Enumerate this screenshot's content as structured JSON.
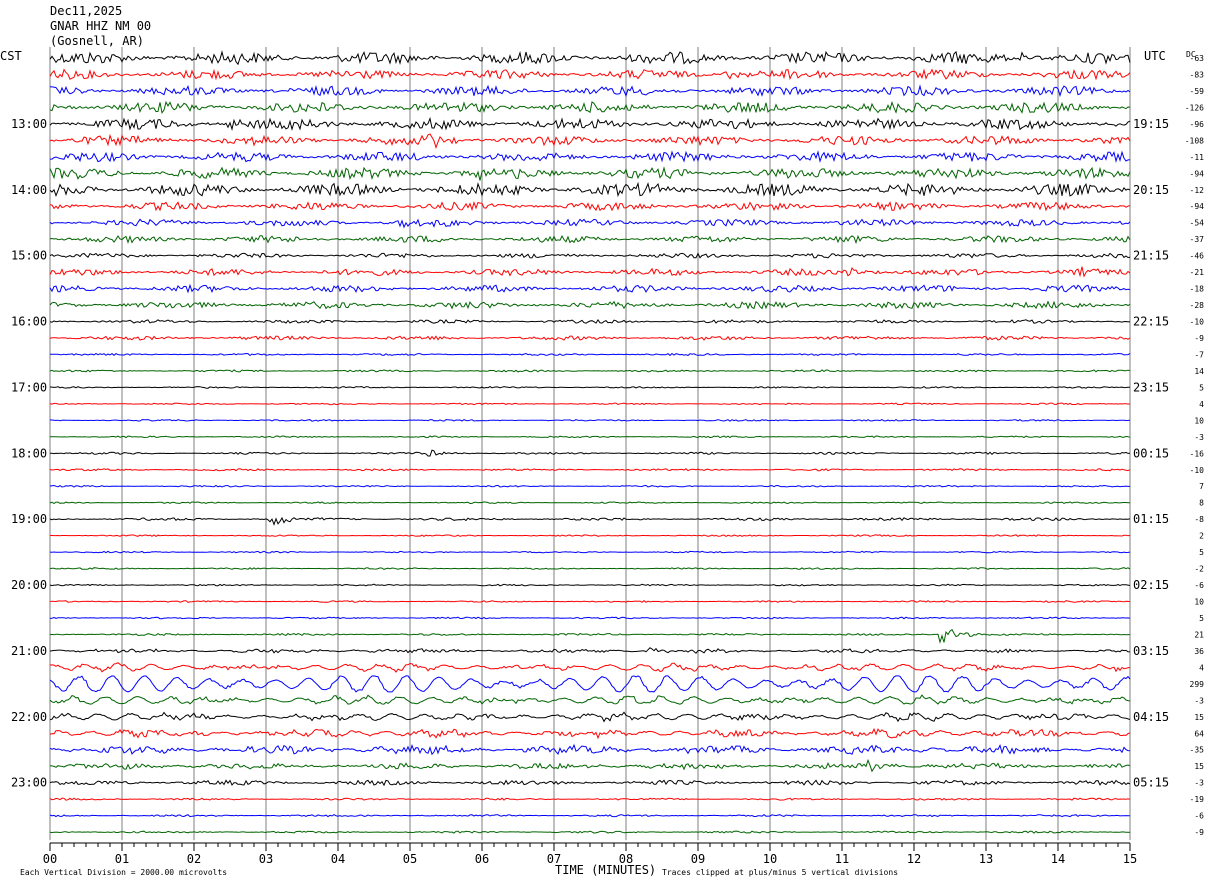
{
  "header": {
    "date": "Dec11,2025",
    "station": "GNAR HHZ NM 00",
    "location": "(Gosnell, AR)"
  },
  "left_timezone": "CST",
  "right_timezone": "UTC",
  "dc_label": "DC",
  "footer": {
    "x_axis_label": "TIME (MINUTES)",
    "scale_note": "Each Vertical Division = 2000.00 microvolts",
    "clip_note": "Traces clipped at plus/minus 5 vertical divisions"
  },
  "colors": {
    "trace_cycle": [
      "#000000",
      "#ff0000",
      "#0000ff",
      "#006400"
    ],
    "grid": "#7f7f7f"
  },
  "chart_data": {
    "type": "line",
    "title": "GNAR HHZ NM 00",
    "xlabel": "TIME (MINUTES)",
    "xlim": [
      0,
      15
    ],
    "x_ticks": [
      "00",
      "01",
      "02",
      "03",
      "04",
      "05",
      "06",
      "07",
      "08",
      "09",
      "10",
      "11",
      "12",
      "13",
      "14",
      "15"
    ],
    "trace_count": 48,
    "trace_interval_minutes": 15,
    "first_trace_start_cst": "12:00",
    "left_hour_labels": [
      {
        "trace": 4,
        "label": "13:00"
      },
      {
        "trace": 8,
        "label": "14:00"
      },
      {
        "trace": 12,
        "label": "15:00"
      },
      {
        "trace": 16,
        "label": "16:00"
      },
      {
        "trace": 20,
        "label": "17:00"
      },
      {
        "trace": 24,
        "label": "18:00"
      },
      {
        "trace": 28,
        "label": "19:00"
      },
      {
        "trace": 32,
        "label": "20:00"
      },
      {
        "trace": 36,
        "label": "21:00"
      },
      {
        "trace": 40,
        "label": "22:00"
      },
      {
        "trace": 44,
        "label": "23:00"
      }
    ],
    "right_hour_labels": [
      {
        "trace": 4,
        "label": "19:15"
      },
      {
        "trace": 8,
        "label": "20:15"
      },
      {
        "trace": 12,
        "label": "21:15"
      },
      {
        "trace": 16,
        "label": "22:15"
      },
      {
        "trace": 20,
        "label": "23:15"
      },
      {
        "trace": 24,
        "label": "00:15"
      },
      {
        "trace": 28,
        "label": "01:15"
      },
      {
        "trace": 32,
        "label": "02:15"
      },
      {
        "trace": 36,
        "label": "03:15"
      },
      {
        "trace": 40,
        "label": "04:15"
      },
      {
        "trace": 44,
        "label": "05:15"
      }
    ],
    "dc_offsets": [
      "-63",
      "-83",
      "-59",
      "-126",
      "-96",
      "-108",
      "-11",
      "-94",
      "-12",
      "-94",
      "-54",
      "-37",
      "-46",
      "-21",
      "-18",
      "-28",
      "-10",
      "-9",
      "-7",
      "14",
      "5",
      "4",
      "10",
      "-3",
      "-16",
      "-10",
      "7",
      "8",
      "-8",
      "2",
      "5",
      "-2",
      "-6",
      "10",
      "5",
      "21",
      "36",
      "4",
      "299",
      "-3",
      "15",
      "64",
      "-35",
      "15",
      "-3",
      "-19",
      "-6",
      "-9"
    ],
    "noise_amplitude_divisions": [
      0.9,
      0.7,
      0.7,
      0.8,
      0.8,
      0.7,
      0.7,
      0.8,
      0.9,
      0.6,
      0.5,
      0.5,
      0.35,
      0.5,
      0.5,
      0.5,
      0.25,
      0.3,
      0.15,
      0.15,
      0.12,
      0.12,
      0.12,
      0.12,
      0.15,
      0.15,
      0.12,
      0.12,
      0.2,
      0.12,
      0.12,
      0.12,
      0.12,
      0.12,
      0.12,
      0.15,
      0.25,
      0.3,
      0.25,
      0.3,
      0.35,
      0.45,
      0.55,
      0.4,
      0.35,
      0.15,
      0.15,
      0.15
    ],
    "swell_amplitude_divisions": [
      0,
      0,
      0,
      0,
      0,
      0,
      0,
      0,
      0,
      0,
      0,
      0,
      0,
      0,
      0,
      0,
      0,
      0,
      0,
      0,
      0,
      0,
      0,
      0,
      0,
      0,
      0,
      0,
      0,
      0,
      0,
      0,
      0,
      0,
      0,
      0,
      0.1,
      0.4,
      1.2,
      0.5,
      0.4,
      0.3,
      0.2,
      0.1,
      0,
      0,
      0,
      0
    ],
    "events": [
      {
        "trace": 0,
        "minute": 13.5,
        "amplitude": 0.6
      },
      {
        "trace": 1,
        "minute": 9.4,
        "amplitude": 0.7
      },
      {
        "trace": 4,
        "minute": 2.5,
        "amplitude": 0.7
      },
      {
        "trace": 5,
        "minute": 5.3,
        "amplitude": 0.9
      },
      {
        "trace": 7,
        "minute": 6.0,
        "amplitude": 0.7
      },
      {
        "trace": 8,
        "minute": 8.3,
        "amplitude": 0.7
      },
      {
        "trace": 10,
        "minute": 4.9,
        "amplitude": 0.8
      },
      {
        "trace": 13,
        "minute": 11.1,
        "amplitude": 0.7
      },
      {
        "trace": 13,
        "minute": 14.2,
        "amplitude": 0.6
      },
      {
        "trace": 24,
        "minute": 5.3,
        "amplitude": 0.5
      },
      {
        "trace": 28,
        "minute": 3.1,
        "amplitude": 0.9
      },
      {
        "trace": 35,
        "minute": 12.4,
        "amplitude": 1.3
      },
      {
        "trace": 36,
        "minute": 8.3,
        "amplitude": 0.5
      },
      {
        "trace": 43,
        "minute": 11.4,
        "amplitude": 0.6
      }
    ]
  }
}
